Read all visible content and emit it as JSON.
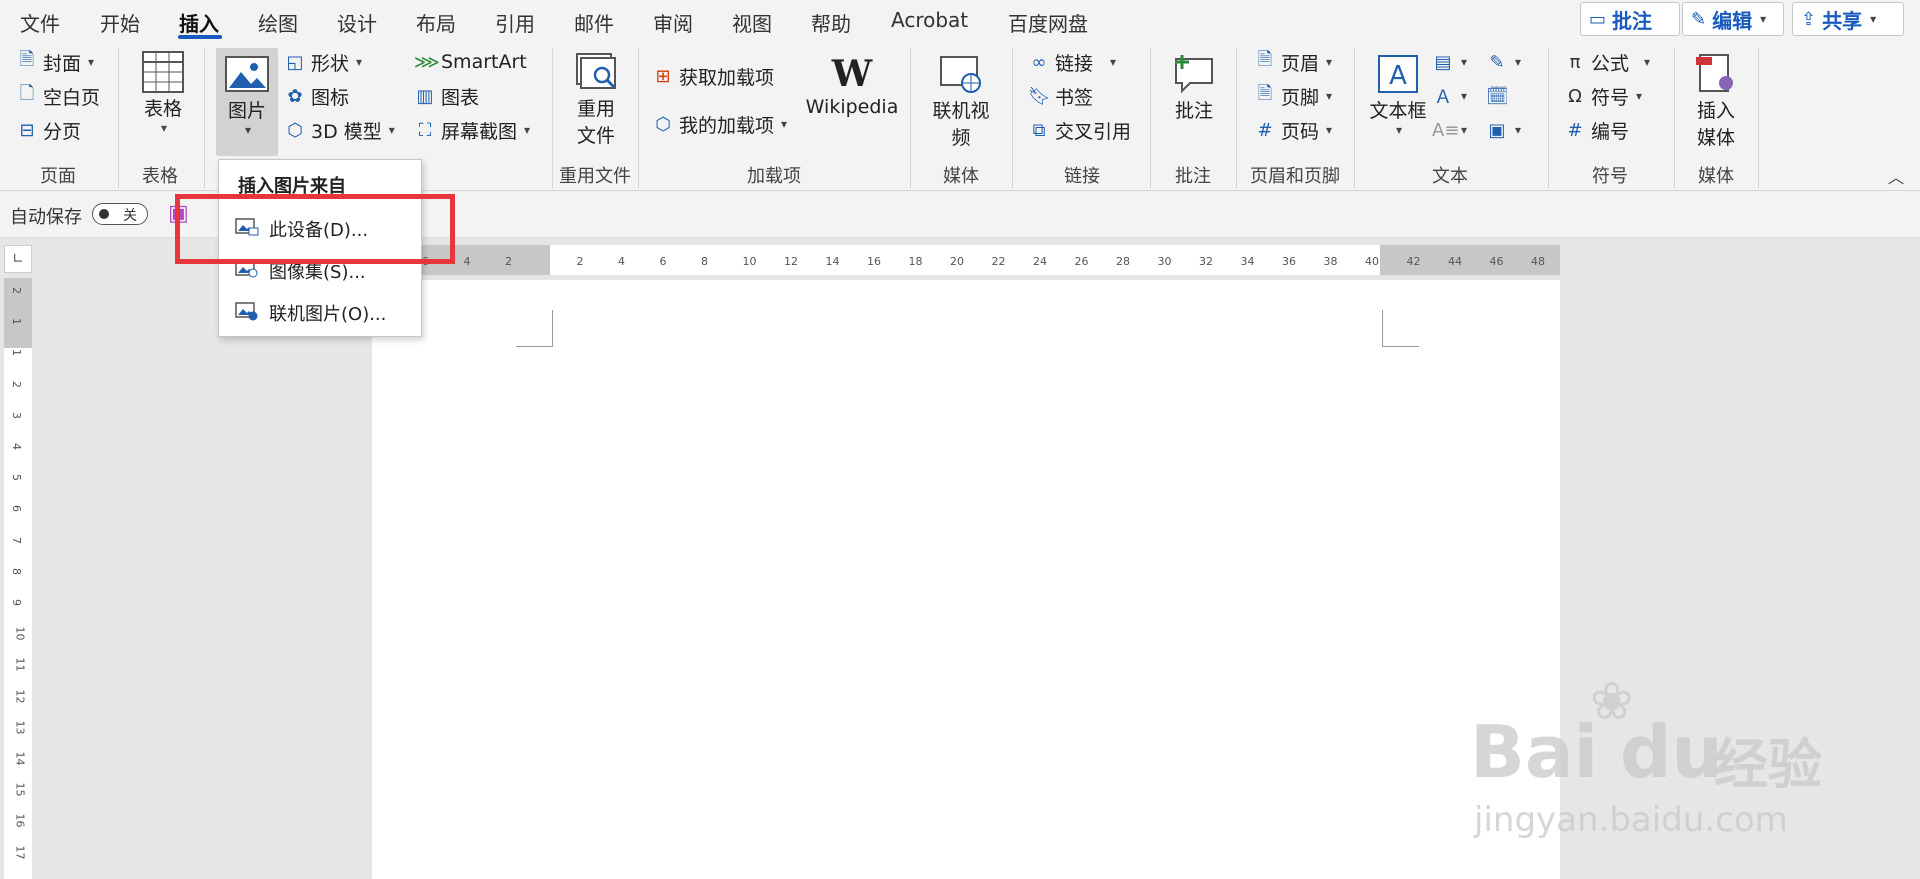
{
  "tabs": [
    "文件",
    "开始",
    "插入",
    "绘图",
    "设计",
    "布局",
    "引用",
    "邮件",
    "审阅",
    "视图",
    "帮助",
    "Acrobat",
    "百度网盘"
  ],
  "active_tab": "插入",
  "top_right": {
    "comment": "批注",
    "edit": "编辑",
    "share": "共享"
  },
  "ribbon": {
    "page_group": {
      "cover": "封面",
      "blank": "空白页",
      "break": "分页",
      "label": "页面"
    },
    "table_group": {
      "table": "表格",
      "label": "表格"
    },
    "illus_group": {
      "picture": "图片",
      "shapes": "形状",
      "icons": "图标",
      "model3d": "3D 模型",
      "smartart": "SmartArt",
      "chart": "图表",
      "screenshot": "屏幕截图"
    },
    "reuse_group": {
      "reuse1": "重用",
      "reuse2": "文件",
      "label": "重用文件"
    },
    "addins_group": {
      "get": "获取加载项",
      "my": "我的加载项",
      "wikipedia": "Wikipedia",
      "label": "加载项"
    },
    "media_group": {
      "video": "联机视频",
      "label": "媒体"
    },
    "links_group": {
      "link": "链接",
      "bookmark": "书签",
      "crossref": "交叉引用",
      "label": "链接"
    },
    "comment_group": {
      "comment": "批注",
      "label": "批注"
    },
    "hf_group": {
      "header": "页眉",
      "footer": "页脚",
      "pagenum": "页码",
      "label": "页眉和页脚"
    },
    "text_group": {
      "textbox": "文本框",
      "label": "文本"
    },
    "symbols_group": {
      "equation": "公式",
      "symbol": "符号",
      "number": "编号",
      "label": "符号"
    },
    "insmedia_group": {
      "ins1": "插入",
      "ins2": "媒体",
      "label": "媒体"
    }
  },
  "qat": {
    "autosave": "自动保存",
    "toggle": "关"
  },
  "dropdown": {
    "header": "插入图片来自",
    "items": [
      "此设备(D)...",
      "图像集(S)...",
      "联机图片(O)..."
    ]
  },
  "ruler_h": [
    "6",
    "4",
    "2",
    "2",
    "4",
    "6",
    "8",
    "10",
    "12",
    "14",
    "16",
    "18",
    "20",
    "22",
    "24",
    "26",
    "28",
    "30",
    "32",
    "34",
    "36",
    "38",
    "40",
    "42",
    "44",
    "46",
    "48"
  ],
  "ruler_v": [
    "2",
    "1",
    "1",
    "2",
    "3",
    "4",
    "5",
    "6",
    "7",
    "8",
    "9",
    "10",
    "11",
    "12",
    "13",
    "14",
    "15",
    "16",
    "17"
  ],
  "watermark": {
    "brand1": "Bai",
    "brand2": "du",
    "brand3": "经验",
    "url": "jingyan.baidu.com"
  }
}
